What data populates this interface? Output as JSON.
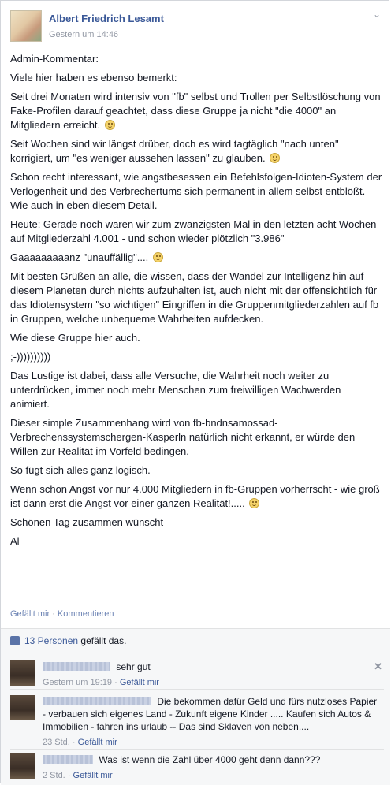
{
  "post": {
    "author": "Albert Friedrich Lesamt",
    "timestamp": "Gestern um 14:46",
    "paragraphs": [
      "Admin-Kommentar:",
      "Viele hier haben es ebenso bemerkt:",
      "Seit drei Monaten wird intensiv von \"fb\" selbst und Trollen per Selbstlöschung von Fake-Profilen darauf geachtet, dass diese Gruppe ja nicht \"die 4000\" an Mitgliedern erreicht.",
      "Seit Wochen sind wir längst drüber, doch es wird tagtäglich \"nach unten\" korrigiert, um \"es weniger aussehen lassen\" zu glauben.",
      "Schon recht interessant, wie angstbesessen ein Befehlsfolgen-Idioten-System der Verlogenheit und des Verbrechertums sich permanent in allem selbst entblößt.",
      "Wie auch in eben diesem Detail.",
      "Heute: Gerade noch waren wir zum zwanzigsten Mal in den letzten acht Wochen auf Mitgliederzahl 4.001 - und schon wieder plötzlich \"3.986\"",
      "Gaaaaaaaaanz \"unauffällig\"....",
      "Mit besten Grüßen an alle, die wissen, dass der Wandel zur Intelligenz hin auf diesem Planeten durch nichts aufzuhalten ist, auch nicht mit der offensichtlich für das Idiotensystem \"so wichtigen\" Eingriffen in die Gruppenmitgliederzahlen auf fb in Gruppen, welche unbequeme Wahrheiten aufdecken.",
      "Wie diese Gruppe hier auch.",
      ";-))))))))))",
      "Das Lustige ist dabei, dass alle Versuche, die Wahrheit noch weiter zu unterdrücken, immer noch mehr Menschen zum freiwilligen Wachwerden animiert.",
      "Dieser simple Zusammenhang wird von fb-bndnsamossad-Verbrechenssystemschergen-Kasperln natürlich nicht erkannt, er würde den Willen zur Realität im Vorfeld bedingen.",
      "So fügt sich alles ganz logisch.",
      "Wenn schon Angst vor nur 4.000 Mitgliedern in fb-Gruppen vorherrscht - wie groß ist dann erst die Angst vor einer ganzen Realität!.....",
      "Schönen Tag zusammen wünscht",
      "Al"
    ],
    "like_action": "Gefällt mir",
    "comment_action": "Kommentieren"
  },
  "likes": {
    "count_link": "13 Personen",
    "suffix": "gefällt das."
  },
  "comments": [
    {
      "text": "sehr gut",
      "time": "Gestern um 19:19",
      "like": "Gefällt mir"
    },
    {
      "text": "Die bekommen dafür Geld und fürs nutzloses Papier - verbauen sich eigenes Land - Zukunft eigene Kinder ..... Kaufen sich Autos & Immobilien - fahren ins urlaub -- Das sind Sklaven von neben....",
      "time": "23 Std.",
      "like": "Gefällt mir"
    },
    {
      "text": "Was ist wenn die Zahl über 4000 geht denn dann???",
      "time": "2 Std.",
      "like": "Gefällt mir"
    }
  ],
  "icons": [
    "chevron-down-icon",
    "smiley-icon",
    "thumbs-up-icon",
    "close-icon"
  ],
  "colors": {
    "link": "#3b5998",
    "meta": "#9197a3",
    "ufi_background": "#f6f7f8"
  }
}
